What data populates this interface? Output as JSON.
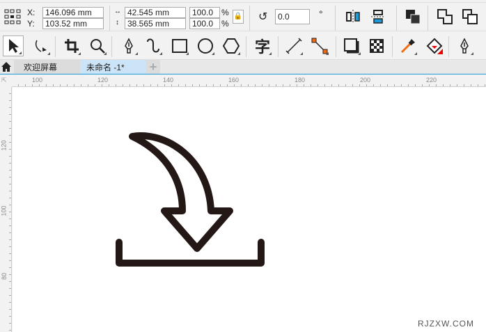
{
  "propbar": {
    "x_label": "X:",
    "y_label": "Y:",
    "x_value": "146.096 mm",
    "y_value": "103.52 mm",
    "width_value": "42.545 mm",
    "height_value": "38.565 mm",
    "scale_x": "100.0",
    "scale_y": "100.0",
    "percent": "%",
    "rotation": "0.0",
    "degree": "°"
  },
  "tabs": [
    {
      "label": "欢迎屏幕"
    },
    {
      "label": "未命名 -1*"
    }
  ],
  "tab_add": "+",
  "ruler_h": [
    "100",
    "120",
    "140",
    "160",
    "180",
    "200",
    "220"
  ],
  "ruler_v": [
    "120",
    "100",
    "80"
  ],
  "watermark": "RJZXW.COM",
  "colors": {
    "accent": "#1e9bd7",
    "stroke": "#231815",
    "active_tab": "#cce4f7"
  }
}
